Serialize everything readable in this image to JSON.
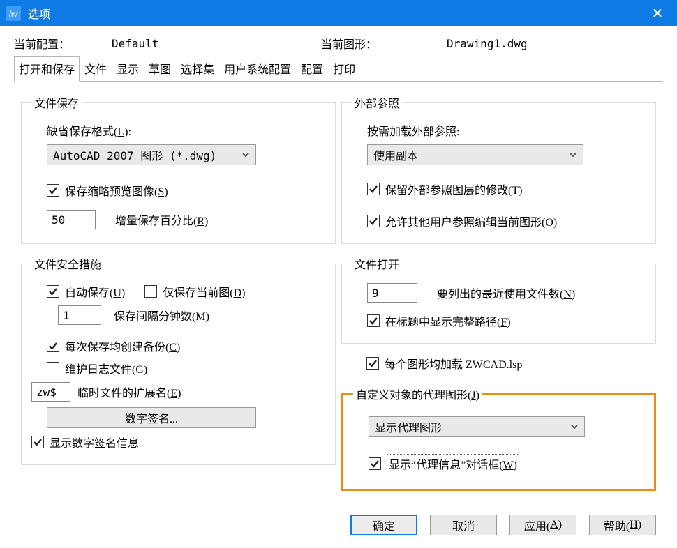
{
  "window": {
    "title": "选项"
  },
  "header": {
    "currentProfileLabel": "当前配置：",
    "currentProfileValue": "Default",
    "currentDrawingLabel": "当前图形：",
    "currentDrawingValue": "Drawing1.dwg"
  },
  "tabs": {
    "items": [
      "打开和保存",
      "文件",
      "显示",
      "草图",
      "选择集",
      "用户系统配置",
      "配置",
      "打印"
    ],
    "activeIndex": 0
  },
  "fileSave": {
    "legend": "文件保存",
    "defaultFormatLabel": "缺省保存格式(",
    "defaultFormatMnemonic": "L",
    "defaultFormatTail": "):",
    "defaultFormatValue": "AutoCAD 2007 图形 (*.dwg)",
    "thumbLabel": "保存缩略预览图像(",
    "thumbMnemonic": "S",
    "thumbTail": ")",
    "incrementalValue": "50",
    "incrementalLabel": "增量保存百分比(",
    "incrementalMnemonic": "R",
    "incrementalTail": ")"
  },
  "fileSafe": {
    "legend": "文件安全措施",
    "autoSaveLabel": "自动保存(",
    "autoSaveMnemonic": "U",
    "autoSaveTail": ")",
    "onlyCurrentLabel": "仅保存当前图(",
    "onlyCurrentMnemonic": "D",
    "onlyCurrentTail": ")",
    "intervalValue": "1",
    "intervalLabel": "保存间隔分钟数(",
    "intervalMnemonic": "M",
    "intervalTail": ")",
    "backupLabel": "每次保存均创建备份(",
    "backupMnemonic": "C",
    "backupTail": ")",
    "logLabel": "维护日志文件(",
    "logMnemonic": "G",
    "logTail": ")",
    "tempExtValue": "zw$",
    "tempExtLabel": "临时文件的扩展名(",
    "tempExtMnemonic": "E",
    "tempExtTail": ")",
    "digitalSignButton": "数字签名...",
    "showDigitalSignLabel": "显示数字签名信息"
  },
  "xref": {
    "legend": "外部参照",
    "demandLoadLabel": "按需加载外部参照:",
    "demandLoadValue": "使用副本",
    "keepLayersLabel": "保留外部参照图层的修改(",
    "keepLayersMnemonic": "T",
    "keepLayersTail": ")",
    "allowOthersLabel": "允许其他用户参照编辑当前图形(",
    "allowOthersMnemonic": "O",
    "allowOthersTail": ")"
  },
  "fileOpen": {
    "legend": "文件打开",
    "recentValue": "9",
    "recentLabel": "要列出的最近使用文件数(",
    "recentMnemonic": "N",
    "recentTail": ")",
    "fullPathLabel": "在标题中显示完整路径(",
    "fullPathMnemonic": "F",
    "fullPathTail": ")"
  },
  "lspLabel": "每个图形均加载 ZWCAD.lsp",
  "proxy": {
    "legend": "自定义对象的代理图形(",
    "legendMnemonic": "J",
    "legendTail": ")",
    "selectValue": "显示代理图形",
    "showDialogLabel": "显示“代理信息”对话框(",
    "showDialogMnemonic": "W",
    "showDialogTail": ")"
  },
  "buttons": {
    "ok": "确定",
    "cancel": "取消",
    "applyLabel": "应用(",
    "applyMnemonic": "A",
    "applyTail": ")",
    "helpLabel": "帮助(",
    "helpMnemonic": "H",
    "helpTail": ")"
  }
}
